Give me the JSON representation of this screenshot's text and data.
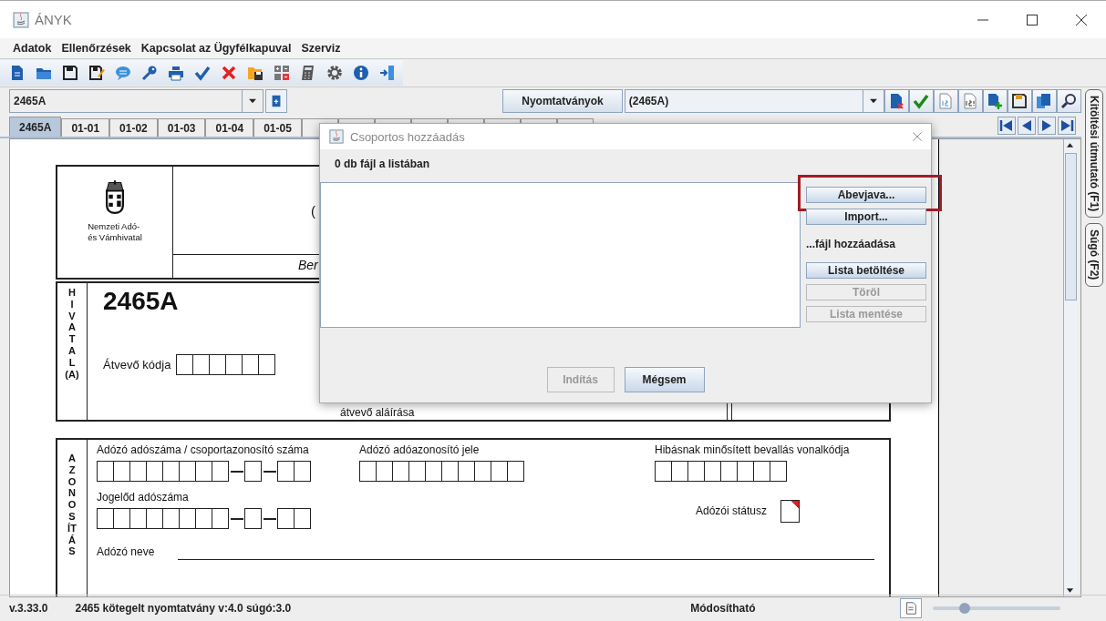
{
  "window": {
    "title": "ÁNYK"
  },
  "menu": [
    "Adatok",
    "Ellenőrzések",
    "Kapcsolat az Ügyfélkapuval",
    "Szerviz"
  ],
  "form_selector": {
    "value": "2465A"
  },
  "forms_button": {
    "label": "Nyomtatványok"
  },
  "form_list": {
    "value": "(2465A)"
  },
  "tabs": [
    {
      "label": "2465A",
      "selected": true
    },
    {
      "label": "01-01",
      "selected": false
    },
    {
      "label": "01-02",
      "selected": false
    },
    {
      "label": "01-03",
      "selected": false
    },
    {
      "label": "01-04",
      "selected": false
    },
    {
      "label": "01-05",
      "selected": false
    }
  ],
  "side_tabs": [
    "Kitöltési útmutató (F1)",
    "Súgó (F2)"
  ],
  "form": {
    "authority": [
      "Nemzeti Adó-",
      "és Vámhivatal"
    ],
    "title_fragment": "(",
    "subtitle_fragment": "Ber",
    "office_section": {
      "label": "HIVATAL",
      "sublabel": "(A)",
      "form_code": "2465A",
      "receiver_code_label": "Átvevő kódja",
      "signature_label": "átvevő aláírása"
    },
    "id_section": {
      "label": "AZONOSÍTÁS",
      "fields": [
        {
          "label": "Adózó adószáma / csoportazonosító száma",
          "kind": "tax-number"
        },
        {
          "label": "Adózó adóazonosító jele",
          "kind": "tax-id"
        },
        {
          "label": "Hibásnak minősített bevallás vonalkódja",
          "kind": "barcode"
        },
        {
          "label": "Jogelőd adószáma",
          "kind": "tax-number"
        },
        {
          "label": "Adózói státusz",
          "kind": "status"
        },
        {
          "label": "Adózó neve",
          "kind": "line"
        }
      ]
    }
  },
  "dialog": {
    "title": "Csoportos hozzáadás",
    "count_label": "0 db fájl a listában",
    "side_items": [
      {
        "kind": "button",
        "label": "Abevjava...",
        "disabled": false,
        "highlighted": true
      },
      {
        "kind": "button",
        "label": "Import...",
        "disabled": false,
        "highlighted": false
      },
      {
        "kind": "caption",
        "label": "...fájl hozzáadása"
      },
      {
        "kind": "button",
        "label": "Lista betöltése",
        "disabled": false,
        "highlighted": false
      },
      {
        "kind": "button",
        "label": "Töröl",
        "disabled": true,
        "highlighted": false
      },
      {
        "kind": "button",
        "label": "Lista mentése",
        "disabled": true,
        "highlighted": false
      }
    ],
    "footer_buttons": [
      {
        "label": "Indítás",
        "disabled": true
      },
      {
        "label": "Mégsem",
        "disabled": false
      }
    ]
  },
  "status_bar": {
    "version": "v.3.33.0",
    "info": "2465 kötegelt nyomtatvány v:4.0 súgó:3.0",
    "mode": "Módosítható",
    "zoom": {
      "level": 0.25
    }
  }
}
